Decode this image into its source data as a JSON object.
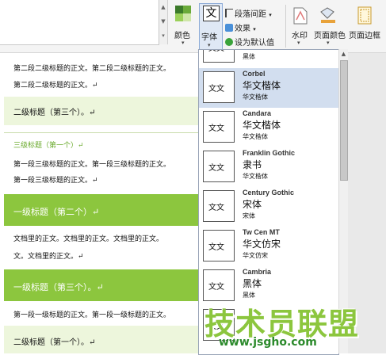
{
  "ribbon": {
    "color_label": "颜色",
    "font_label": "字体",
    "font_glyph": "文",
    "paragraph_spacing_label": "段落间距",
    "effects_label": "效果",
    "set_default_label": "设为默认值",
    "watermark_label": "水印",
    "page_color_label": "页面颜色",
    "page_border_label": "页面边框"
  },
  "document": {
    "lines": [
      {
        "type": "body",
        "text": "第二段二级标题的正文。第二段二级标题的正文。"
      },
      {
        "type": "body",
        "text": "第二段二级标题的正文。↵"
      },
      {
        "type": "h2",
        "text": "二级标题（第三个）。↵"
      },
      {
        "type": "h3",
        "text": "三级标题（第一个）↵"
      },
      {
        "type": "body",
        "text": "第一段三级标题的正文。第一段三级标题的正文。"
      },
      {
        "type": "body",
        "text": "第一段三级标题的正文。↵"
      },
      {
        "type": "h1",
        "text": "一级标题（第二个）↵"
      },
      {
        "type": "body",
        "text": "文档里的正文。文档里的正文。文档里的正文。"
      },
      {
        "type": "body",
        "text": "文。文档里的正文。↵"
      },
      {
        "type": "h1",
        "text": "一级标题（第三个）。↵"
      },
      {
        "type": "body",
        "text": "第一段一级标题的正文。第一段一级标题的正文。"
      },
      {
        "type": "h2",
        "text": "二级标题（第一个）。↵"
      }
    ]
  },
  "font_dropdown": {
    "preview_text": "文文",
    "partial_top_sample": "黑体",
    "items": [
      {
        "name": "Corbel",
        "sample_cn": "华文楷体",
        "sample_small": "华文楷体",
        "selected": true
      },
      {
        "name": "Candara",
        "sample_cn": "华文楷体",
        "sample_small": "华文楷体",
        "selected": false
      },
      {
        "name": "Franklin Gothic",
        "sample_cn": "隶书",
        "sample_small": "华文楷体",
        "selected": false
      },
      {
        "name": "Century Gothic",
        "sample_cn": "宋体",
        "sample_small": "宋体",
        "selected": false
      },
      {
        "name": "Tw Cen MT",
        "sample_cn": "华文仿宋",
        "sample_small": "华文仿宋",
        "selected": false
      },
      {
        "name": "Cambria",
        "sample_cn": "黑体",
        "sample_small": "黑体",
        "selected": false
      }
    ]
  },
  "watermark": {
    "text": "技术员联盟",
    "url": "www.jsgho.com"
  },
  "colors": {
    "accent_green": "#8cc63e",
    "selection_blue": "#d2deef"
  }
}
